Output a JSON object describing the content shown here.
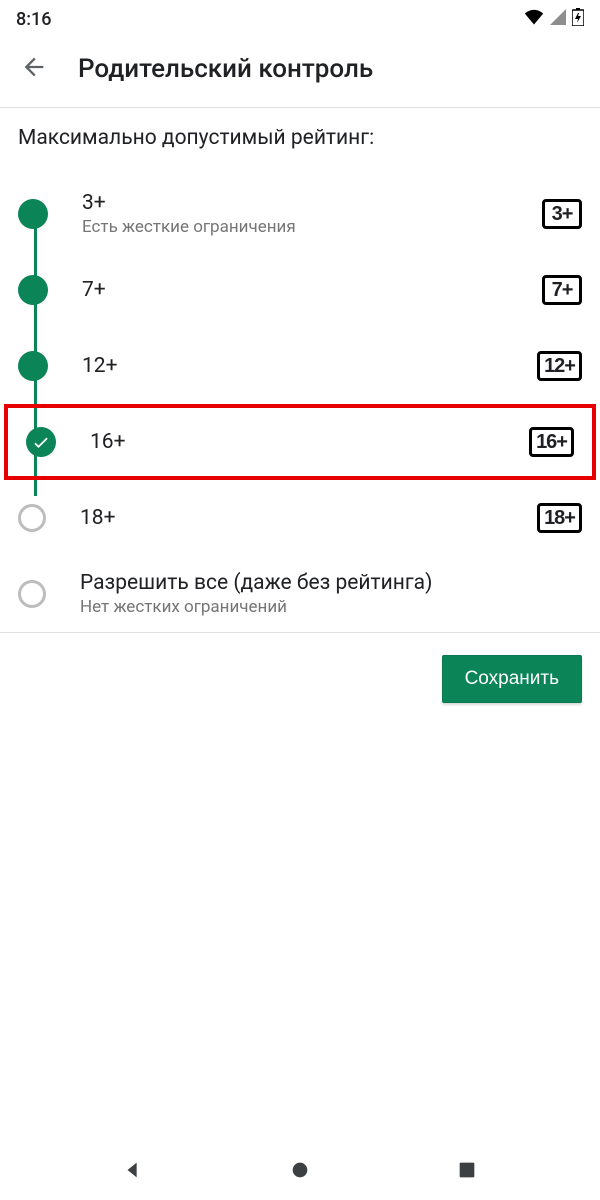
{
  "status": {
    "time": "8:16"
  },
  "header": {
    "title": "Родительский контроль"
  },
  "section_label": "Максимально допустимый рейтинг:",
  "options": [
    {
      "label": "3+",
      "sub": "Есть жесткие ограничения",
      "badge": "3+",
      "state": "filled",
      "highlighted": false
    },
    {
      "label": "7+",
      "sub": "",
      "badge": "7+",
      "state": "filled",
      "highlighted": false
    },
    {
      "label": "12+",
      "sub": "",
      "badge": "12+",
      "state": "filled",
      "highlighted": false
    },
    {
      "label": "16+",
      "sub": "",
      "badge": "16+",
      "state": "checked",
      "highlighted": true
    },
    {
      "label": "18+",
      "sub": "",
      "badge": "18+",
      "state": "empty",
      "highlighted": false
    },
    {
      "label": "Разрешить все (даже без рейтинга)",
      "sub": "Нет жестких ограничений",
      "badge": "",
      "state": "empty",
      "highlighted": false
    }
  ],
  "save_label": "Сохранить"
}
